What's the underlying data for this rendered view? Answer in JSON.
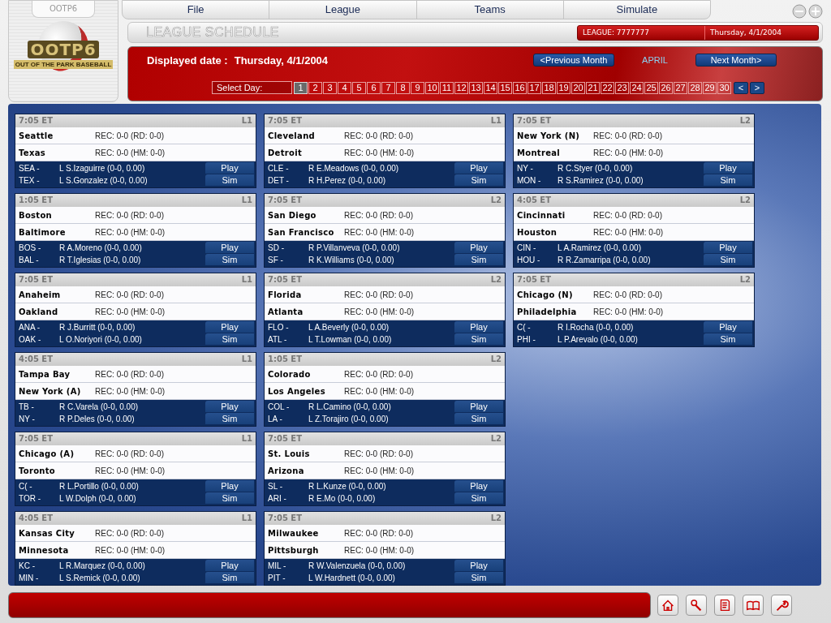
{
  "app": {
    "tab_label": "OOTP6",
    "logo_title": "OOTP6",
    "logo_subtitle": "OUT OF THE PARK BASEBALL"
  },
  "menu": [
    "File",
    "League",
    "Teams",
    "Simulate"
  ],
  "title_bar": {
    "title": "LEAGUE SCHEDULE",
    "league_label": "LEAGUE: 7777777",
    "date": "Thursday, 4/1/2004"
  },
  "banner": {
    "displayed_date_label": "Displayed date :",
    "displayed_date": "Thursday, 4/1/2004",
    "prev_button": "<Previous Month",
    "month": "APRIL",
    "next_button": "Next Month>",
    "select_day_label": "Select Day:",
    "days": [
      {
        "label": "1",
        "selected": true
      },
      {
        "label": "2",
        "selected": false
      },
      {
        "label": "3",
        "selected": false
      },
      {
        "label": "4",
        "selected": false
      },
      {
        "label": "5",
        "selected": false
      },
      {
        "label": "6",
        "selected": false
      },
      {
        "label": "7",
        "selected": false
      },
      {
        "label": "8",
        "selected": false
      },
      {
        "label": "9",
        "selected": false
      },
      {
        "label": "10",
        "selected": false
      },
      {
        "label": "11",
        "selected": false
      },
      {
        "label": "12",
        "selected": false
      },
      {
        "label": "13",
        "selected": false
      },
      {
        "label": "14",
        "selected": false
      },
      {
        "label": "15",
        "selected": false
      },
      {
        "label": "16",
        "selected": false
      },
      {
        "label": "17",
        "selected": false
      },
      {
        "label": "18",
        "selected": false
      },
      {
        "label": "19",
        "selected": false
      },
      {
        "label": "20",
        "selected": false
      },
      {
        "label": "21",
        "selected": false
      },
      {
        "label": "22",
        "selected": false
      },
      {
        "label": "23",
        "selected": false
      },
      {
        "label": "24",
        "selected": false
      },
      {
        "label": "25",
        "selected": false
      },
      {
        "label": "26",
        "selected": false
      },
      {
        "label": "27",
        "selected": false
      },
      {
        "label": "28",
        "selected": false
      },
      {
        "label": "29",
        "selected": false
      },
      {
        "label": "30",
        "selected": false
      }
    ],
    "prev_day": "<",
    "next_day": ">"
  },
  "columns": [
    [
      {
        "time": "7:05 ET",
        "league": "L1",
        "away": {
          "team": "Seattle",
          "record": "REC: 0-0 (RD: 0-0)",
          "abbr": "SEA -",
          "pitcher": "L S.Izaguirre (0-0, 0.00)"
        },
        "home": {
          "team": "Texas",
          "record": "REC: 0-0 (HM: 0-0)",
          "abbr": "TEX -",
          "pitcher": "L S.Gonzalez (0-0, 0.00)"
        },
        "play": "Play",
        "sim": "Sim"
      },
      {
        "time": "1:05 ET",
        "league": "L1",
        "away": {
          "team": "Boston",
          "record": "REC: 0-0 (RD: 0-0)",
          "abbr": "BOS -",
          "pitcher": "R A.Moreno (0-0, 0.00)"
        },
        "home": {
          "team": "Baltimore",
          "record": "REC: 0-0 (HM: 0-0)",
          "abbr": "BAL -",
          "pitcher": "R T.Iglesias (0-0, 0.00)"
        },
        "play": "Play",
        "sim": "Sim"
      },
      {
        "time": "7:05 ET",
        "league": "L1",
        "away": {
          "team": "Anaheim",
          "record": "REC: 0-0 (RD: 0-0)",
          "abbr": "ANA -",
          "pitcher": "R J.Burritt (0-0, 0.00)"
        },
        "home": {
          "team": "Oakland",
          "record": "REC: 0-0 (HM: 0-0)",
          "abbr": "OAK -",
          "pitcher": "L O.Noriyori (0-0, 0.00)"
        },
        "play": "Play",
        "sim": "Sim"
      },
      {
        "time": "4:05 ET",
        "league": "L1",
        "away": {
          "team": "Tampa Bay",
          "record": "REC: 0-0 (RD: 0-0)",
          "abbr": "TB -",
          "pitcher": "R C.Varela (0-0, 0.00)"
        },
        "home": {
          "team": "New York (A)",
          "record": "REC: 0-0 (HM: 0-0)",
          "abbr": "NY -",
          "pitcher": "R P.Deles (0-0, 0.00)"
        },
        "play": "Play",
        "sim": "Sim"
      },
      {
        "time": "7:05 ET",
        "league": "L1",
        "away": {
          "team": "Chicago (A)",
          "record": "REC: 0-0 (RD: 0-0)",
          "abbr": "C( -",
          "pitcher": "R L.Portillo (0-0, 0.00)"
        },
        "home": {
          "team": "Toronto",
          "record": "REC: 0-0 (HM: 0-0)",
          "abbr": "TOR -",
          "pitcher": "L W.Dolph (0-0, 0.00)"
        },
        "play": "Play",
        "sim": "Sim"
      },
      {
        "time": "4:05 ET",
        "league": "L1",
        "away": {
          "team": "Kansas City",
          "record": "REC: 0-0 (RD: 0-0)",
          "abbr": "KC -",
          "pitcher": "L R.Marquez (0-0, 0.00)"
        },
        "home": {
          "team": "Minnesota",
          "record": "REC: 0-0 (HM: 0-0)",
          "abbr": "MIN -",
          "pitcher": "L S.Remick (0-0, 0.00)"
        },
        "play": "Play",
        "sim": "Sim"
      }
    ],
    [
      {
        "time": "7:05 ET",
        "league": "L1",
        "away": {
          "team": "Cleveland",
          "record": "REC: 0-0 (RD: 0-0)",
          "abbr": "CLE -",
          "pitcher": "R E.Meadows (0-0, 0.00)"
        },
        "home": {
          "team": "Detroit",
          "record": "REC: 0-0 (HM: 0-0)",
          "abbr": "DET -",
          "pitcher": "R H.Perez (0-0, 0.00)"
        },
        "play": "Play",
        "sim": "Sim"
      },
      {
        "time": "7:05 ET",
        "league": "L2",
        "away": {
          "team": "San Diego",
          "record": "REC: 0-0 (RD: 0-0)",
          "abbr": "SD -",
          "pitcher": "R P.Villanveva (0-0, 0.00)"
        },
        "home": {
          "team": "San Francisco",
          "record": "REC: 0-0 (HM: 0-0)",
          "abbr": "SF -",
          "pitcher": "R K.Williams (0-0, 0.00)"
        },
        "play": "Play",
        "sim": "Sim"
      },
      {
        "time": "7:05 ET",
        "league": "L2",
        "away": {
          "team": "Florida",
          "record": "REC: 0-0 (RD: 0-0)",
          "abbr": "FLO -",
          "pitcher": "L A.Beverly (0-0, 0.00)"
        },
        "home": {
          "team": "Atlanta",
          "record": "REC: 0-0 (HM: 0-0)",
          "abbr": "ATL -",
          "pitcher": "L T.Lowman (0-0, 0.00)"
        },
        "play": "Play",
        "sim": "Sim"
      },
      {
        "time": "1:05 ET",
        "league": "L2",
        "away": {
          "team": "Colorado",
          "record": "REC: 0-0 (RD: 0-0)",
          "abbr": "COL -",
          "pitcher": "R L.Camino (0-0, 0.00)"
        },
        "home": {
          "team": "Los Angeles",
          "record": "REC: 0-0 (HM: 0-0)",
          "abbr": "LA -",
          "pitcher": "L Z.Torajiro (0-0, 0.00)"
        },
        "play": "Play",
        "sim": "Sim"
      },
      {
        "time": "7:05 ET",
        "league": "L2",
        "away": {
          "team": "St. Louis",
          "record": "REC: 0-0 (RD: 0-0)",
          "abbr": "SL -",
          "pitcher": "R L.Kunze (0-0, 0.00)"
        },
        "home": {
          "team": "Arizona",
          "record": "REC: 0-0 (HM: 0-0)",
          "abbr": "ARI -",
          "pitcher": "R E.Mo (0-0, 0.00)"
        },
        "play": "Play",
        "sim": "Sim"
      },
      {
        "time": "7:05 ET",
        "league": "L2",
        "away": {
          "team": "Milwaukee",
          "record": "REC: 0-0 (RD: 0-0)",
          "abbr": "MIL -",
          "pitcher": "R W.Valenzuela (0-0, 0.00)"
        },
        "home": {
          "team": "Pittsburgh",
          "record": "REC: 0-0 (HM: 0-0)",
          "abbr": "PIT -",
          "pitcher": "L W.Hardnett (0-0, 0.00)"
        },
        "play": "Play",
        "sim": "Sim"
      }
    ],
    [
      {
        "time": "7:05 ET",
        "league": "L2",
        "away": {
          "team": "New York (N)",
          "record": "REC: 0-0 (RD: 0-0)",
          "abbr": "NY -",
          "pitcher": "R C.Styer (0-0, 0.00)"
        },
        "home": {
          "team": "Montreal",
          "record": "REC: 0-0 (HM: 0-0)",
          "abbr": "MON -",
          "pitcher": "R S.Ramirez (0-0, 0.00)"
        },
        "play": "Play",
        "sim": "Sim"
      },
      {
        "time": "4:05 ET",
        "league": "L2",
        "away": {
          "team": "Cincinnati",
          "record": "REC: 0-0 (RD: 0-0)",
          "abbr": "CIN -",
          "pitcher": "L A.Ramirez (0-0, 0.00)"
        },
        "home": {
          "team": "Houston",
          "record": "REC: 0-0 (HM: 0-0)",
          "abbr": "HOU -",
          "pitcher": "R R.Zamarripa (0-0, 0.00)"
        },
        "play": "Play",
        "sim": "Sim"
      },
      {
        "time": "7:05 ET",
        "league": "L2",
        "away": {
          "team": "Chicago (N)",
          "record": "REC: 0-0 (RD: 0-0)",
          "abbr": "C( -",
          "pitcher": "R I.Rocha (0-0, 0.00)"
        },
        "home": {
          "team": "Philadelphia",
          "record": "REC: 0-0 (HM: 0-0)",
          "abbr": "PHI -",
          "pitcher": "L P.Arevalo (0-0, 0.00)"
        },
        "play": "Play",
        "sim": "Sim"
      }
    ]
  ]
}
